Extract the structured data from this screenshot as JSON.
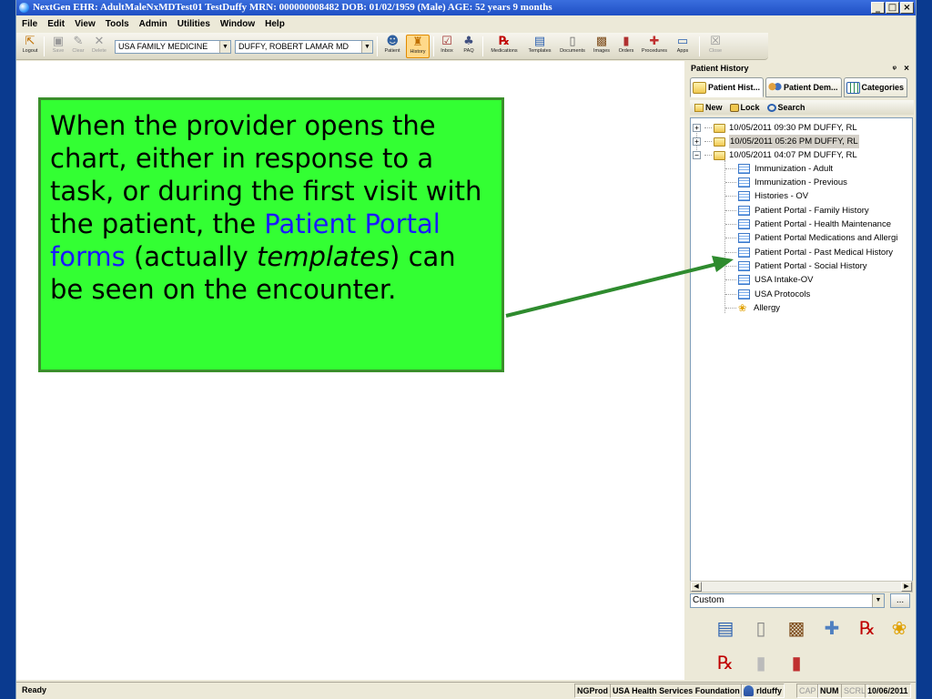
{
  "window": {
    "title": "NextGen EHR: AdultMaleNxMDTest01 TestDuffy  MRN: 000000008482  DOB: 01/02/1959  (Male)  AGE: 52 years 9 months",
    "controls": [
      "_",
      "□",
      "×"
    ]
  },
  "menu": [
    "File",
    "Edit",
    "View",
    "Tools",
    "Admin",
    "Utilities",
    "Window",
    "Help"
  ],
  "toolbar": {
    "logout": "Logout",
    "save": "Save",
    "clear": "Clear",
    "delete": "Delete",
    "practice": "USA FAMILY MEDICINE",
    "provider": "DUFFY, ROBERT  LAMAR MD",
    "patient": "Patient",
    "history": "History",
    "inbox": "Inbox",
    "paq": "PAQ",
    "medications": "Medications",
    "templates": "Templates",
    "documents": "Documents",
    "images": "Images",
    "orders": "Orders",
    "procedures": "Procedures",
    "apps": "Apps",
    "close": "Close"
  },
  "callout": {
    "text1": "When the provider opens the chart, either in response to a task, or during the first visit with the patient, the ",
    "highlight": "Patient Portal forms",
    "text2": " (actually ",
    "italic": "templates",
    "text3": ") can be seen on the encounter."
  },
  "panel": {
    "title": "Patient History",
    "pin": "ᵠ",
    "close": "×",
    "tabs": [
      "Patient Hist...",
      "Patient Dem...",
      "Categories"
    ],
    "tools": [
      "New",
      "Lock",
      "Search"
    ],
    "encounters": [
      "10/05/2011 09:30 PM   DUFFY, RL",
      "10/05/2011 05:26 PM   DUFFY, RL",
      "10/05/2011 04:07 PM   DUFFY, RL"
    ],
    "items": [
      "Immunization - Adult",
      "Immunization - Previous",
      "Histories - OV",
      "Patient Portal -  Family History",
      "Patient Portal - Health Maintenance",
      "Patient Portal Medications and Allergi",
      "Patient Portal - Past Medical History",
      "Patient Portal - Social History",
      "USA Intake-OV",
      "USA Protocols",
      "Allergy"
    ],
    "filter": "Custom",
    "ellipsis": "..."
  },
  "status": {
    "ready": "Ready",
    "db": "NGProd",
    "org": "USA Health Services Foundation",
    "user": "rlduffy",
    "cap": "CAP",
    "num": "NUM",
    "scrl": "SCRL",
    "date": "10/06/2011"
  },
  "colors": {
    "callout_bg": "#33ff33",
    "callout_border": "#3a8f2b",
    "highlight": "#1a1aff",
    "titlebar": "#1f4fc4"
  }
}
